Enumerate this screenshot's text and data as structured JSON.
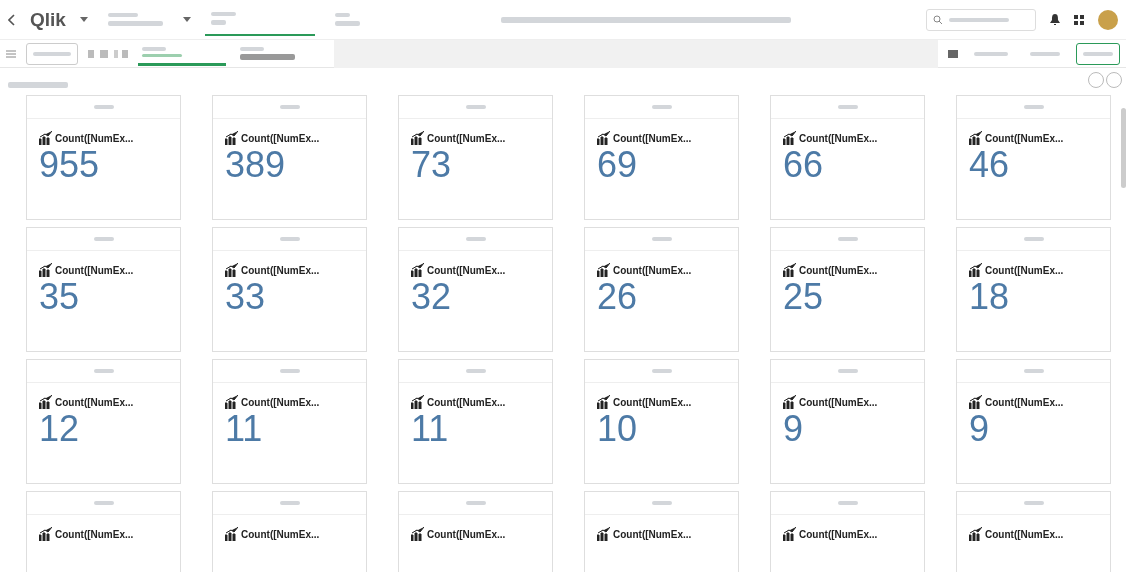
{
  "header": {
    "logo": "Qlik"
  },
  "cards": [
    {
      "measure": "Count([NumEx...",
      "value": "955"
    },
    {
      "measure": "Count([NumEx...",
      "value": "389"
    },
    {
      "measure": "Count([NumEx...",
      "value": "73"
    },
    {
      "measure": "Count([NumEx...",
      "value": "69"
    },
    {
      "measure": "Count([NumEx...",
      "value": "66"
    },
    {
      "measure": "Count([NumEx...",
      "value": "46"
    },
    {
      "measure": "Count([NumEx...",
      "value": "35"
    },
    {
      "measure": "Count([NumEx...",
      "value": "33"
    },
    {
      "measure": "Count([NumEx...",
      "value": "32"
    },
    {
      "measure": "Count([NumEx...",
      "value": "26"
    },
    {
      "measure": "Count([NumEx...",
      "value": "25"
    },
    {
      "measure": "Count([NumEx...",
      "value": "18"
    },
    {
      "measure": "Count([NumEx...",
      "value": "12"
    },
    {
      "measure": "Count([NumEx...",
      "value": "11"
    },
    {
      "measure": "Count([NumEx...",
      "value": "11"
    },
    {
      "measure": "Count([NumEx...",
      "value": "10"
    },
    {
      "measure": "Count([NumEx...",
      "value": "9"
    },
    {
      "measure": "Count([NumEx...",
      "value": "9"
    },
    {
      "measure": "Count([NumEx..."
    },
    {
      "measure": "Count([NumEx..."
    },
    {
      "measure": "Count([NumEx..."
    },
    {
      "measure": "Count([NumEx..."
    },
    {
      "measure": "Count([NumEx..."
    },
    {
      "measure": "Count([NumEx..."
    }
  ]
}
